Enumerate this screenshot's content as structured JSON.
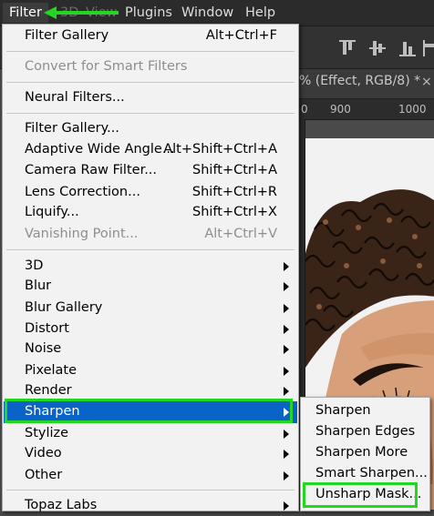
{
  "menubar": {
    "items": [
      "Filter",
      "3D",
      "View",
      "Plugins",
      "Window",
      "Help"
    ],
    "active": "Filter"
  },
  "document": {
    "tab_label": "% (Effect, RGB/8) *",
    "close_glyph": "×",
    "ruler_numbers": [
      "0",
      "900",
      "1000"
    ]
  },
  "filter_menu": {
    "last_filter": {
      "label": "Filter Gallery",
      "shortcut": "Alt+Ctrl+F"
    },
    "convert_smart": {
      "label": "Convert for Smart Filters"
    },
    "neural": {
      "label": "Neural Filters..."
    },
    "gallery": {
      "label": "Filter Gallery..."
    },
    "adaptive": {
      "label": "Adaptive Wide Angle...",
      "shortcut": "Alt+Shift+Ctrl+A"
    },
    "camera_raw": {
      "label": "Camera Raw Filter...",
      "shortcut": "Shift+Ctrl+A"
    },
    "lens": {
      "label": "Lens Correction...",
      "shortcut": "Shift+Ctrl+R"
    },
    "liquify": {
      "label": "Liquify...",
      "shortcut": "Shift+Ctrl+X"
    },
    "vanishing": {
      "label": "Vanishing Point...",
      "shortcut": "Alt+Ctrl+V"
    },
    "submenus": [
      "3D",
      "Blur",
      "Blur Gallery",
      "Distort",
      "Noise",
      "Pixelate",
      "Render",
      "Sharpen",
      "Stylize",
      "Video",
      "Other",
      "Topaz Labs"
    ]
  },
  "sharpen_submenu": {
    "items": [
      "Sharpen",
      "Sharpen Edges",
      "Sharpen More",
      "Smart Sharpen...",
      "Unsharp Mask..."
    ]
  },
  "colors": {
    "highlight_blue": "#0a64c8",
    "annotation_green": "#22d622",
    "menu_bg": "#f2f2f2",
    "app_bg": "#2b2b2b"
  }
}
